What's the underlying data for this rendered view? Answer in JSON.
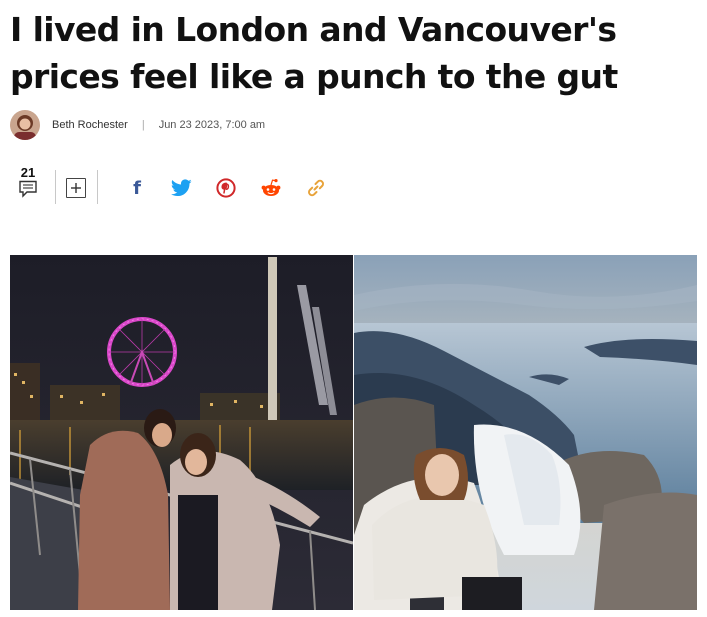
{
  "article": {
    "headline": "I lived in London and Vancouver's prices feel like a punch to the gut",
    "author": "Beth Rochester",
    "separator": "|",
    "date": "Jun 23 2023, 7:00 am"
  },
  "share_bar": {
    "comment_count": "21",
    "icons": [
      "comment-icon",
      "add-icon",
      "facebook-icon",
      "twitter-icon",
      "pinterest-icon",
      "reddit-icon",
      "link-icon"
    ],
    "facebook_glyph": "f"
  },
  "colors": {
    "facebook": "#3b5998",
    "twitter": "#1da1f2",
    "pinterest": "#d0282a",
    "reddit": "#ff4500",
    "link": "#e8a33a",
    "text": "#111111"
  },
  "photos": [
    {
      "name": "london-night-photo"
    },
    {
      "name": "vancouver-mountain-photo"
    }
  ]
}
